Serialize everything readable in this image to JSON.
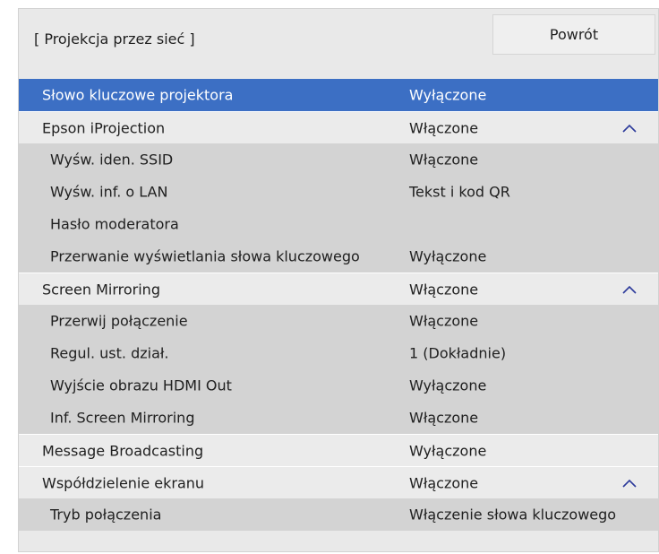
{
  "header": {
    "title": "[ Projekcja przez sieć ]",
    "back_label": "Powrót"
  },
  "colors": {
    "selected_row": "#3c6fc4",
    "group_row": "#ebebeb",
    "sub_row": "#d3d3d3",
    "panel_bg": "#e9e9e9"
  },
  "rows": [
    {
      "label": "Słowo kluczowe projektora",
      "value": "Wyłączone",
      "level": 1,
      "selected": true
    },
    {
      "label": "Epson iProjection",
      "value": "Włączone",
      "level": 1,
      "expanded": true,
      "icon": "chevron-up-icon"
    },
    {
      "label": "Wyśw. iden. SSID",
      "value": "Włączone",
      "level": 2
    },
    {
      "label": "Wyśw. inf. o LAN",
      "value": "Tekst i kod QR",
      "level": 2
    },
    {
      "label": "Hasło moderatora",
      "value": "",
      "level": 2
    },
    {
      "label": "Przerwanie wyświetlania słowa kluczowego",
      "value": "Wyłączone",
      "level": 2
    },
    {
      "label": "Screen Mirroring",
      "value": "Włączone",
      "level": 1,
      "expanded": true,
      "icon": "chevron-up-icon"
    },
    {
      "label": "Przerwij połączenie",
      "value": "Włączone",
      "level": 2
    },
    {
      "label": "Regul. ust. dział.",
      "value": "1 (Dokładnie)",
      "level": 2
    },
    {
      "label": "Wyjście obrazu HDMI Out",
      "value": "Wyłączone",
      "level": 2
    },
    {
      "label": "Inf. Screen Mirroring",
      "value": "Włączone",
      "level": 2
    },
    {
      "label": "Message Broadcasting",
      "value": "Wyłączone",
      "level": 1
    },
    {
      "label": "Współdzielenie ekranu",
      "value": "Włączone",
      "level": 1,
      "expanded": true,
      "icon": "chevron-up-icon"
    },
    {
      "label": "Tryb połączenia",
      "value": "Włączenie słowa kluczowego",
      "level": 2
    }
  ]
}
